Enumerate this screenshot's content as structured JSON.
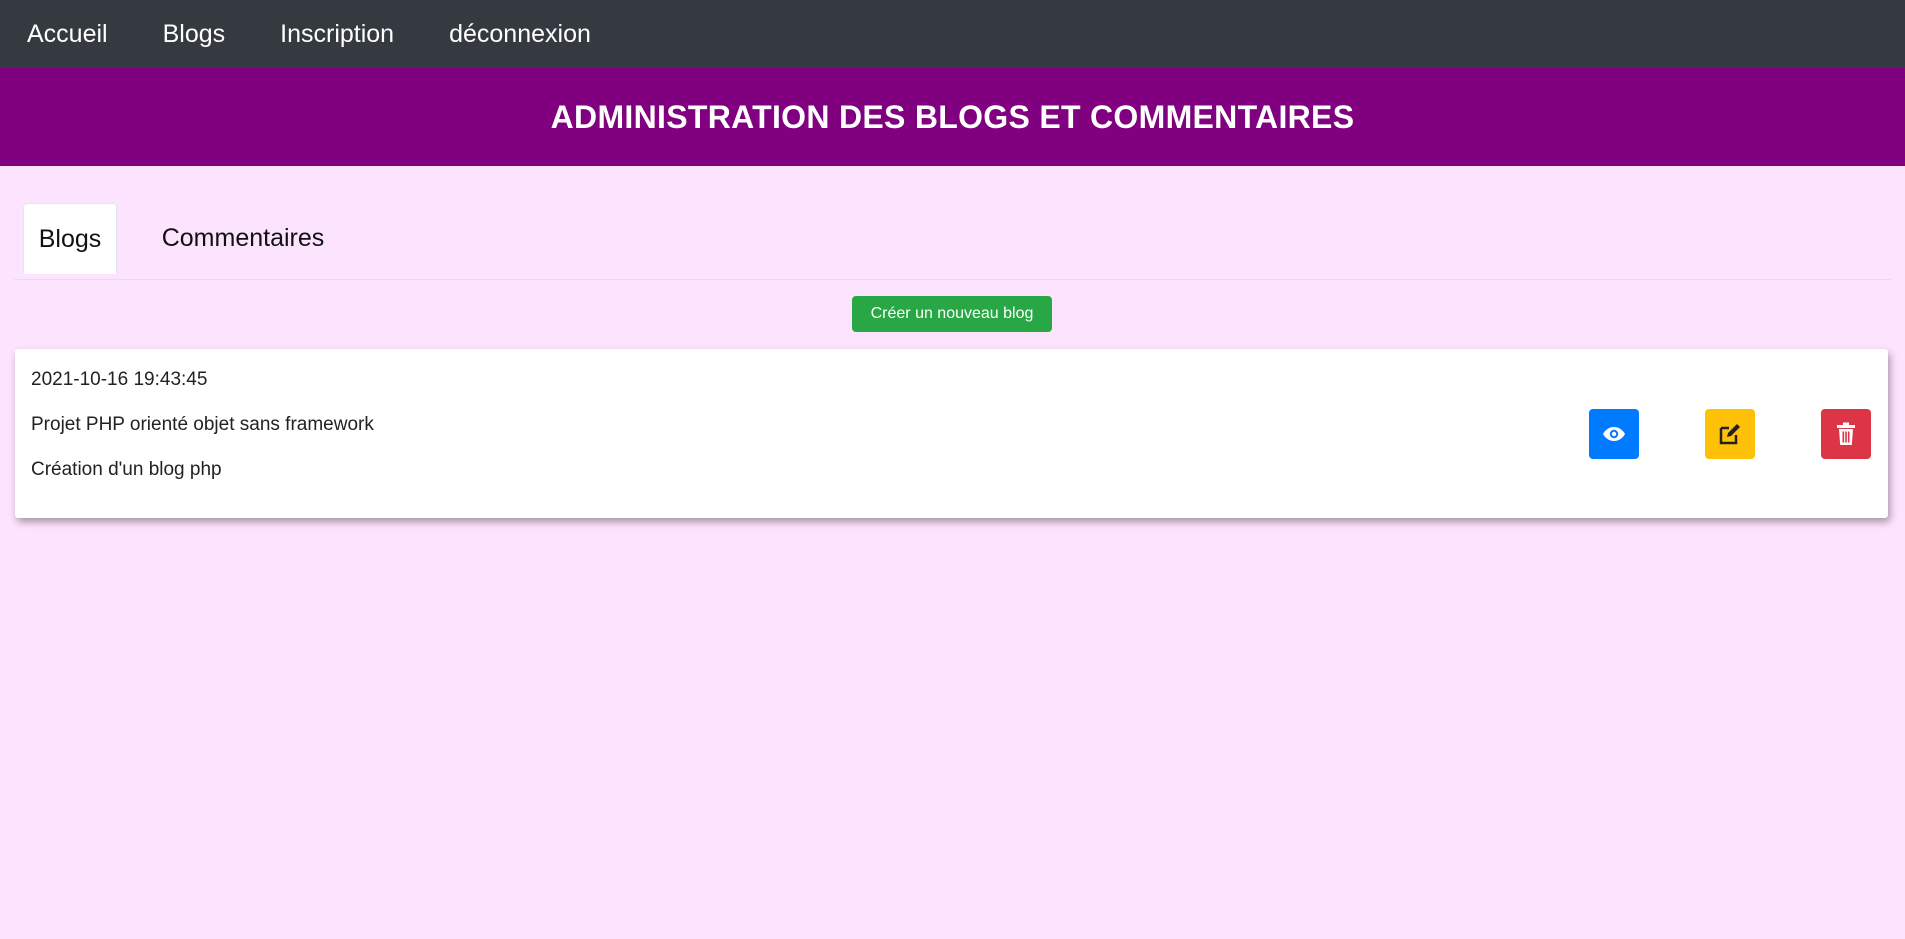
{
  "nav": {
    "items": [
      "Accueil",
      "Blogs",
      "Inscription",
      "déconnexion"
    ]
  },
  "banner": {
    "title": "ADMINISTRATION DES BLOGS ET COMMENTAIRES"
  },
  "tabs": [
    {
      "label": "Blogs",
      "active": true
    },
    {
      "label": "Commentaires",
      "active": false
    }
  ],
  "create_button": {
    "label": "Créer un nouveau blog"
  },
  "blogs": [
    {
      "date": "2021-10-16 19:43:45",
      "title": "Projet PHP orienté objet sans framework",
      "description": "Création d'un blog php",
      "actions": {
        "view_icon": "eye-icon",
        "edit_icon": "edit-icon",
        "delete_icon": "trash-icon"
      }
    }
  ],
  "colors": {
    "nav_bg": "#343a40",
    "banner_bg": "#800080",
    "page_bg": "#fde4fe",
    "create": "#28a745",
    "view": "#007bff",
    "edit": "#ffc107",
    "delete": "#dc3545"
  }
}
